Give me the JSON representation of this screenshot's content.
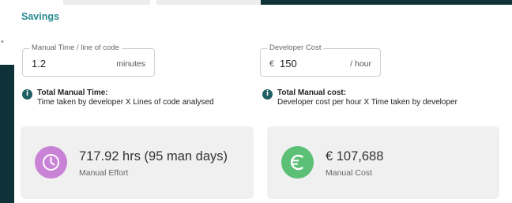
{
  "section_title": "Savings",
  "manual_time": {
    "label": "Manual Time / line of code",
    "value": "1.2",
    "unit": "minutes"
  },
  "developer_cost": {
    "label": "Developer Cost",
    "prefix": "€",
    "value": "150",
    "unit": "/ hour"
  },
  "info_time": {
    "title": "Total Manual Time:",
    "description": "Time taken by developer X Lines of code analysed"
  },
  "info_cost": {
    "title": "Total Manual cost:",
    "description": "Developer cost per hour X Time taken by developer"
  },
  "effort_card": {
    "value": "717.92 hrs (95 man days)",
    "label": "Manual Effort",
    "icon": "clock-icon",
    "color": "#c983d6"
  },
  "cost_card": {
    "value": "€ 107,688",
    "label": "Manual Cost",
    "icon": "euro-icon",
    "color": "#5cbf76"
  },
  "colors": {
    "accent": "#2a8a8f",
    "info_icon": "#1f5f63",
    "backdrop": "#0f3138"
  }
}
